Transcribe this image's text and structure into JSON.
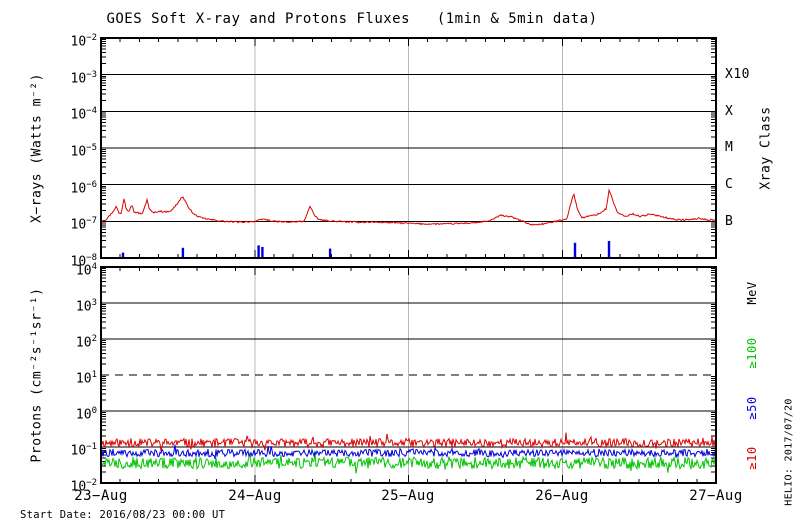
{
  "title": "GOES Soft X-ray and Protons Fluxes   (1min & 5min data)",
  "start_date_note": "Start Date: 2016/08/23 00:00 UT",
  "credit": "HELIO: 2017/07/20",
  "colors": {
    "xray_long": "#dd0000",
    "xray_short": "#0000dd",
    "p10": "#dd0000",
    "p50": "#0000dd",
    "p100": "#00c400",
    "grid": "#b8b8b8",
    "frame": "#000000"
  },
  "x_axis": {
    "labels": [
      "23−Aug",
      "24−Aug",
      "25−Aug",
      "26−Aug",
      "27−Aug"
    ],
    "span_days": 4,
    "minor_ticks_per_day": 8
  },
  "chart_data": [
    {
      "type": "line",
      "panel": "xray",
      "ylabel": "X−rays (Watts m⁻²)",
      "right_label": "Xray Class",
      "ylog_exponents": [
        -2,
        -3,
        -4,
        -5,
        -6,
        -7,
        -8
      ],
      "class_labels": [
        {
          "label": "X10",
          "exponent": -3
        },
        {
          "label": "X",
          "exponent": -4
        },
        {
          "label": "M",
          "exponent": -5
        },
        {
          "label": "C",
          "exponent": -6
        },
        {
          "label": "B",
          "exponent": -7
        }
      ],
      "series": [
        {
          "name": "xray-long-1min",
          "color": "#dd0000",
          "style": "noisy-line",
          "log_jitter": 0.02,
          "points_day_flux": [
            [
              0,
              1.05e-07
            ],
            [
              0.03,
              1.1e-07
            ],
            [
              0.06,
              1.5e-07
            ],
            [
              0.08,
              1.9e-07
            ],
            [
              0.1,
              2.6e-07
            ],
            [
              0.115,
              1.7e-07
            ],
            [
              0.13,
              1.6e-07
            ],
            [
              0.15,
              4.3e-07
            ],
            [
              0.163,
              2.3e-07
            ],
            [
              0.18,
              1.9e-07
            ],
            [
              0.2,
              2.9e-07
            ],
            [
              0.215,
              1.8e-07
            ],
            [
              0.24,
              1.7e-07
            ],
            [
              0.27,
              1.6e-07
            ],
            [
              0.3,
              4e-07
            ],
            [
              0.315,
              2.1e-07
            ],
            [
              0.34,
              1.7e-07
            ],
            [
              0.38,
              1.9e-07
            ],
            [
              0.42,
              1.8e-07
            ],
            [
              0.46,
              2e-07
            ],
            [
              0.5,
              3.2e-07
            ],
            [
              0.53,
              4.8e-07
            ],
            [
              0.56,
              2.8e-07
            ],
            [
              0.6,
              1.6e-07
            ],
            [
              0.65,
              1.25e-07
            ],
            [
              0.72,
              1.1e-07
            ],
            [
              0.8,
              1e-07
            ],
            [
              0.9,
              9.5e-08
            ],
            [
              1.0,
              1e-07
            ],
            [
              1.06,
              1.15e-07
            ],
            [
              1.12,
              1e-07
            ],
            [
              1.22,
              9.5e-08
            ],
            [
              1.32,
              1e-07
            ],
            [
              1.36,
              2.6e-07
            ],
            [
              1.385,
              1.5e-07
            ],
            [
              1.42,
              1.1e-07
            ],
            [
              1.52,
              1e-07
            ],
            [
              1.65,
              9.5e-08
            ],
            [
              1.8,
              9.5e-08
            ],
            [
              1.95,
              9e-08
            ],
            [
              2.1,
              8.5e-08
            ],
            [
              2.25,
              8.5e-08
            ],
            [
              2.4,
              9e-08
            ],
            [
              2.52,
              1e-07
            ],
            [
              2.6,
              1.45e-07
            ],
            [
              2.66,
              1.35e-07
            ],
            [
              2.73,
              1.05e-07
            ],
            [
              2.8,
              8e-08
            ],
            [
              2.88,
              8.5e-08
            ],
            [
              2.96,
              1e-07
            ],
            [
              3.03,
              1.2e-07
            ],
            [
              3.075,
              5.9e-07
            ],
            [
              3.1,
              2e-07
            ],
            [
              3.13,
              1.25e-07
            ],
            [
              3.18,
              1.4e-07
            ],
            [
              3.24,
              1.6e-07
            ],
            [
              3.285,
              2.2e-07
            ],
            [
              3.305,
              7.2e-07
            ],
            [
              3.33,
              3.6e-07
            ],
            [
              3.36,
              1.7e-07
            ],
            [
              3.41,
              1.35e-07
            ],
            [
              3.46,
              1.6e-07
            ],
            [
              3.51,
              1.35e-07
            ],
            [
              3.56,
              1.55e-07
            ],
            [
              3.62,
              1.45e-07
            ],
            [
              3.68,
              1.25e-07
            ],
            [
              3.75,
              1.1e-07
            ],
            [
              3.82,
              1.1e-07
            ],
            [
              3.89,
              1.2e-07
            ],
            [
              3.95,
              1.1e-07
            ],
            [
              4,
              1.1e-07
            ]
          ]
        },
        {
          "name": "xray-short-5min-spikes",
          "color": "#0000dd",
          "style": "spikes",
          "baseline": 1e-08,
          "points_day_flux": [
            [
              0.143,
              1.4e-08
            ],
            [
              0.533,
              1.9e-08
            ],
            [
              1.025,
              2.2e-08
            ],
            [
              1.05,
              2e-08
            ],
            [
              1.49,
              1.8e-08
            ],
            [
              3.083,
              2.6e-08
            ],
            [
              3.304,
              2.9e-08
            ]
          ]
        }
      ]
    },
    {
      "type": "line",
      "panel": "protons",
      "ylabel": "Protons (cm⁻²s⁻¹sr⁻¹)",
      "right_label": "MeV",
      "ylog_exponents": [
        4,
        3,
        2,
        1,
        0,
        -1,
        -2
      ],
      "event_threshold": {
        "value": 10,
        "style": "dashed"
      },
      "series": [
        {
          "name": "≥10",
          "color": "#dd0000",
          "style": "noisy-band",
          "base": 0.13,
          "log_noise": 0.12,
          "seed": 11
        },
        {
          "name": "≥50",
          "color": "#0000dd",
          "style": "noisy-band",
          "base": 0.068,
          "log_noise": 0.1,
          "seed": 22
        },
        {
          "name": "≥100",
          "color": "#00c400",
          "style": "noisy-band",
          "base": 0.036,
          "log_noise": 0.16,
          "seed": 33
        }
      ]
    }
  ]
}
